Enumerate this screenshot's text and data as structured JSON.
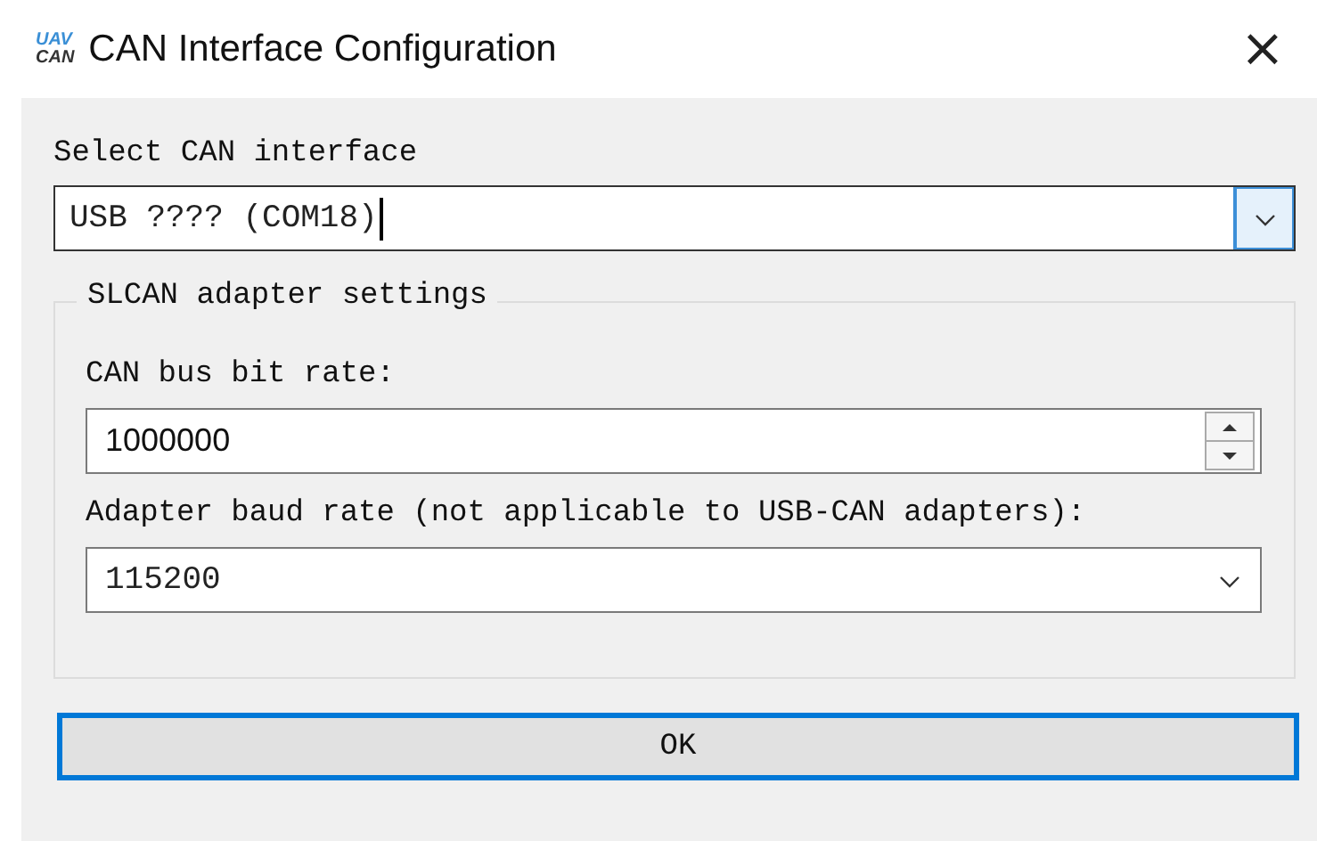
{
  "window": {
    "logo": [
      "UAV",
      "CAN"
    ],
    "title": "CAN Interface Configuration",
    "close": "×"
  },
  "interface": {
    "label": "Select CAN interface",
    "value": "USB ???? (COM18)"
  },
  "group": {
    "title": "SLCAN adapter settings",
    "bitrate": {
      "label": "CAN bus bit rate:",
      "value": "1000000"
    },
    "baud": {
      "label": "Adapter baud rate (not applicable to USB-CAN adapters):",
      "value": "115200"
    }
  },
  "buttons": [
    "OK"
  ]
}
